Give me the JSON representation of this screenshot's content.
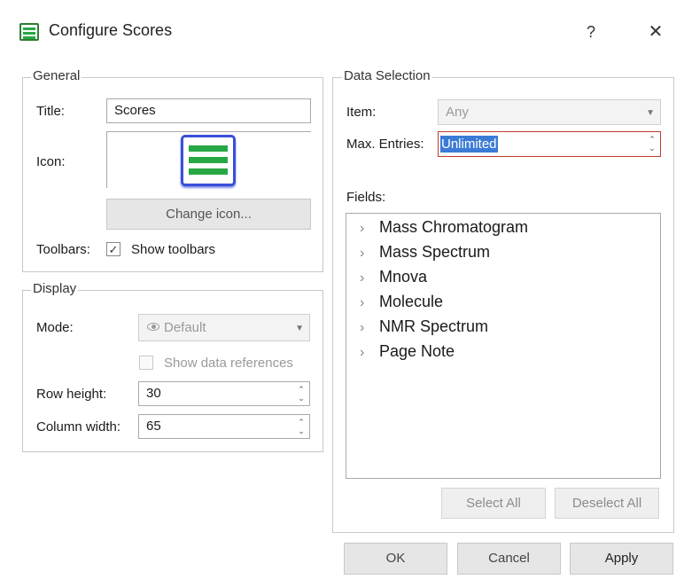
{
  "dialog": {
    "title": "Configure Scores",
    "help_label": "?",
    "close_label": "✕"
  },
  "general": {
    "legend": "General",
    "title_label": "Title:",
    "title_value": "Scores",
    "icon_label": "Icon:",
    "change_icon_label": "Change icon...",
    "toolbars_label": "Toolbars:",
    "show_toolbars_label": "Show toolbars",
    "show_toolbars_checked": true
  },
  "display": {
    "legend": "Display",
    "mode_label": "Mode:",
    "mode_value": "Default",
    "show_data_refs_label": "Show data references",
    "row_height_label": "Row height:",
    "row_height_value": "30",
    "column_width_label": "Column width:",
    "column_width_value": "65"
  },
  "data_selection": {
    "legend": "Data Selection",
    "item_label": "Item:",
    "item_value": "Any",
    "max_entries_label": "Max. Entries:",
    "max_entries_value": "Unlimited",
    "fields_label": "Fields:",
    "fields": [
      "Mass Chromatogram",
      "Mass Spectrum",
      "Mnova",
      "Molecule",
      "NMR Spectrum",
      "Page Note"
    ],
    "select_all_label": "Select All",
    "deselect_all_label": "Deselect All"
  },
  "footer": {
    "ok_label": "OK",
    "cancel_label": "Cancel",
    "apply_label": "Apply"
  },
  "colors": {
    "accent_green": "#27a844",
    "icon_blue": "#3a4fd8",
    "selection_blue": "#3b7bd6",
    "focus_red": "#c0392b"
  }
}
